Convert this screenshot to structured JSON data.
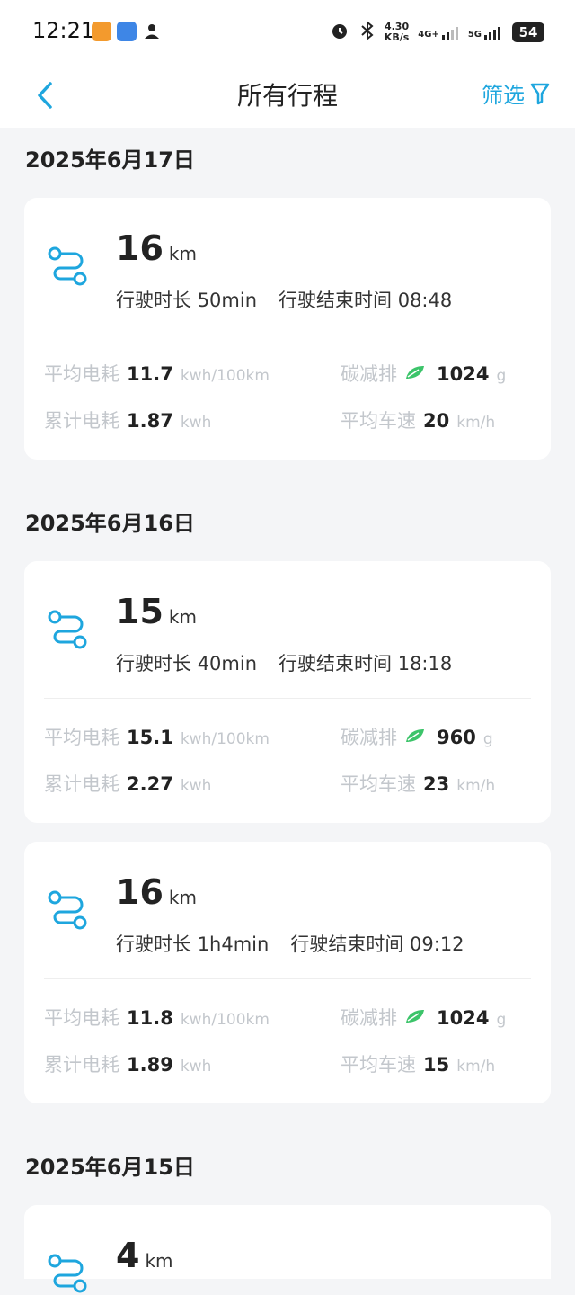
{
  "status": {
    "time": "12:21",
    "speed_top": "4.30",
    "speed_bottom": "KB/s",
    "net1": "4G+",
    "net2": "5G",
    "battery": "54"
  },
  "nav": {
    "title": "所有行程",
    "filter_label": "筛选"
  },
  "labels": {
    "duration": "行驶时长",
    "end_time": "行驶结束时间",
    "avg_consumption": "平均电耗",
    "total_consumption": "累计电耗",
    "carbon": "碳减排",
    "avg_speed": "平均车速",
    "km": "km",
    "kwh_per_100km": "kwh/100km",
    "kwh": "kwh",
    "g": "g",
    "kmh": "km/h"
  },
  "dates": [
    "2025年6月17日",
    "2025年6月16日",
    "2025年6月15日"
  ],
  "trips": [
    {
      "distance": "16",
      "duration": "50min",
      "end_time": "08:48",
      "avg_consumption": "11.7",
      "total_consumption": "1.87",
      "carbon": "1024",
      "avg_speed": "20"
    },
    {
      "distance": "15",
      "duration": "40min",
      "end_time": "18:18",
      "avg_consumption": "15.1",
      "total_consumption": "2.27",
      "carbon": "960",
      "avg_speed": "23"
    },
    {
      "distance": "16",
      "duration": "1h4min",
      "end_time": "09:12",
      "avg_consumption": "11.8",
      "total_consumption": "1.89",
      "carbon": "1024",
      "avg_speed": "15"
    },
    {
      "distance": "4"
    }
  ],
  "colors": {
    "accent": "#1ea6de",
    "leaf": "#3cc46a"
  }
}
